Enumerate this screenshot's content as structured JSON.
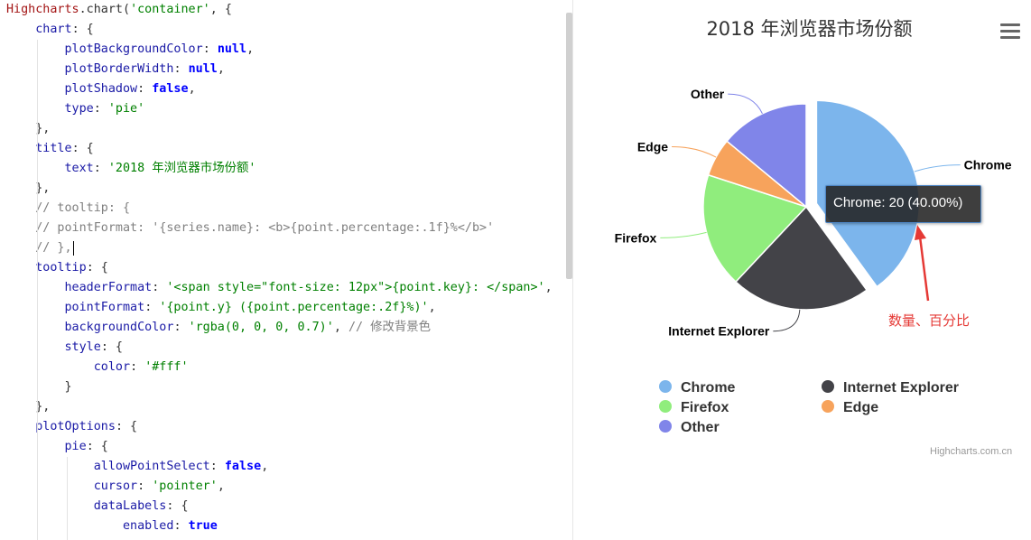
{
  "editor": {
    "code_lines": [
      [
        [
          "fn",
          "Highcharts"
        ],
        [
          "plain",
          ".chart("
        ],
        [
          "str",
          "'container'"
        ],
        [
          "plain",
          ", {"
        ]
      ],
      [
        [
          "plain",
          "    "
        ],
        [
          "prop",
          "chart"
        ],
        [
          "plain",
          ": {"
        ]
      ],
      [
        [
          "plain",
          "        "
        ],
        [
          "prop",
          "plotBackgroundColor"
        ],
        [
          "plain",
          ": "
        ],
        [
          "kw",
          "null"
        ],
        [
          "plain",
          ","
        ]
      ],
      [
        [
          "plain",
          "        "
        ],
        [
          "prop",
          "plotBorderWidth"
        ],
        [
          "plain",
          ": "
        ],
        [
          "kw",
          "null"
        ],
        [
          "plain",
          ","
        ]
      ],
      [
        [
          "plain",
          "        "
        ],
        [
          "prop",
          "plotShadow"
        ],
        [
          "plain",
          ": "
        ],
        [
          "kw",
          "false"
        ],
        [
          "plain",
          ","
        ]
      ],
      [
        [
          "plain",
          "        "
        ],
        [
          "prop",
          "type"
        ],
        [
          "plain",
          ": "
        ],
        [
          "str",
          "'pie'"
        ]
      ],
      [
        [
          "plain",
          "    },"
        ]
      ],
      [
        [
          "plain",
          "    "
        ],
        [
          "prop",
          "title"
        ],
        [
          "plain",
          ": {"
        ]
      ],
      [
        [
          "plain",
          "        "
        ],
        [
          "prop",
          "text"
        ],
        [
          "plain",
          ": "
        ],
        [
          "str",
          "'2018 年浏览器市场份额'"
        ]
      ],
      [
        [
          "plain",
          "    },"
        ]
      ],
      [
        [
          "plain",
          "    "
        ],
        [
          "cmt",
          "// tooltip: {"
        ]
      ],
      [
        [
          "plain",
          "    "
        ],
        [
          "cmt",
          "// pointFormat: '{series.name}: <b>{point.percentage:.1f}%</b>'"
        ]
      ],
      [
        [
          "plain",
          "    "
        ],
        [
          "cmt",
          "// },"
        ]
      ],
      [
        [
          "plain",
          "    "
        ],
        [
          "prop",
          "tooltip"
        ],
        [
          "plain",
          ": {"
        ]
      ],
      [
        [
          "plain",
          "        "
        ],
        [
          "prop",
          "headerFormat"
        ],
        [
          "plain",
          ": "
        ],
        [
          "str",
          "'<span style=\"font-size: 12px\">{point.key}: </span>'"
        ],
        [
          "plain",
          ","
        ]
      ],
      [
        [
          "plain",
          "        "
        ],
        [
          "prop",
          "pointFormat"
        ],
        [
          "plain",
          ": "
        ],
        [
          "str",
          "'{point.y} ({point.percentage:.2f}%)'"
        ],
        [
          "plain",
          ","
        ]
      ],
      [
        [
          "plain",
          "        "
        ],
        [
          "prop",
          "backgroundColor"
        ],
        [
          "plain",
          ": "
        ],
        [
          "str",
          "'rgba(0, 0, 0, 0.7)'"
        ],
        [
          "plain",
          ", "
        ],
        [
          "cmt",
          "// 修改背景色"
        ]
      ],
      [
        [
          "plain",
          "        "
        ],
        [
          "prop",
          "style"
        ],
        [
          "plain",
          ": {"
        ]
      ],
      [
        [
          "plain",
          "            "
        ],
        [
          "prop",
          "color"
        ],
        [
          "plain",
          ": "
        ],
        [
          "str",
          "'#fff'"
        ]
      ],
      [
        [
          "plain",
          "        }"
        ]
      ],
      [
        [
          "plain",
          "    },"
        ]
      ],
      [
        [
          "plain",
          "    "
        ],
        [
          "prop",
          "plotOptions"
        ],
        [
          "plain",
          ": {"
        ]
      ],
      [
        [
          "plain",
          "        "
        ],
        [
          "prop",
          "pie"
        ],
        [
          "plain",
          ": {"
        ]
      ],
      [
        [
          "plain",
          "            "
        ],
        [
          "prop",
          "allowPointSelect"
        ],
        [
          "plain",
          ": "
        ],
        [
          "kw",
          "false"
        ],
        [
          "plain",
          ","
        ]
      ],
      [
        [
          "plain",
          "            "
        ],
        [
          "prop",
          "cursor"
        ],
        [
          "plain",
          ": "
        ],
        [
          "str",
          "'pointer'"
        ],
        [
          "plain",
          ","
        ]
      ],
      [
        [
          "plain",
          "            "
        ],
        [
          "prop",
          "dataLabels"
        ],
        [
          "plain",
          ": {"
        ]
      ],
      [
        [
          "plain",
          "                "
        ],
        [
          "prop",
          "enabled"
        ],
        [
          "plain",
          ": "
        ],
        [
          "kw",
          "true"
        ]
      ]
    ]
  },
  "chart": {
    "menu_icon": "hamburger-menu-icon",
    "tooltip_text": "Chrome: 20 (40.00%)",
    "annotation_text": "数量、百分比",
    "credits": "Highcharts.com.cn"
  },
  "chart_data": {
    "type": "pie",
    "title": "2018 年浏览器市场份额",
    "legend_placement": "bottom",
    "slices": [
      {
        "name": "Chrome",
        "value": 20,
        "percent": 40.0,
        "color": "#7cb5ec",
        "selected": true
      },
      {
        "name": "Internet Explorer",
        "value": 11,
        "percent": 22.0,
        "color": "#434348"
      },
      {
        "name": "Firefox",
        "value": 9,
        "percent": 18.0,
        "color": "#90ed7d"
      },
      {
        "name": "Edge",
        "value": 3,
        "percent": 6.0,
        "color": "#f7a35c"
      },
      {
        "name": "Other",
        "value": 7,
        "percent": 14.0,
        "color": "#8085e9"
      }
    ]
  }
}
